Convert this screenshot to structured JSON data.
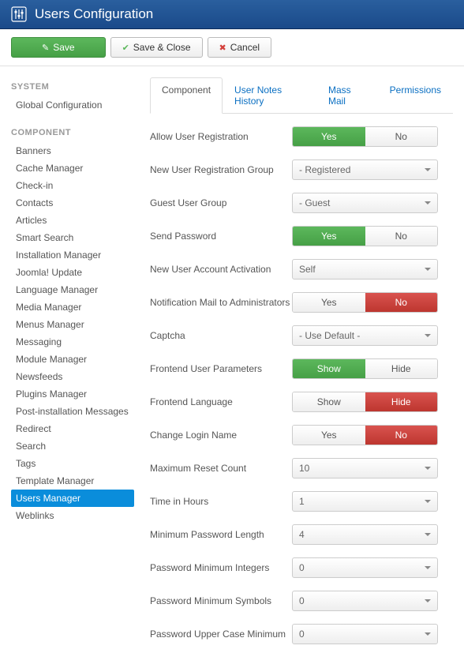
{
  "header": {
    "title": "Users Configuration"
  },
  "toolbar": {
    "save": "Save",
    "save_close": "Save & Close",
    "cancel": "Cancel"
  },
  "sidebar": {
    "system_head": "SYSTEM",
    "global_config": "Global Configuration",
    "component_head": "COMPONENT",
    "items": [
      "Banners",
      "Cache Manager",
      "Check-in",
      "Contacts",
      "Articles",
      "Smart Search",
      "Installation Manager",
      "Joomla! Update",
      "Language Manager",
      "Media Manager",
      "Menus Manager",
      "Messaging",
      "Module Manager",
      "Newsfeeds",
      "Plugins Manager",
      "Post-installation Messages",
      "Redirect",
      "Search",
      "Tags",
      "Template Manager",
      "Users Manager",
      "Weblinks"
    ],
    "active_index": 20
  },
  "tabs": {
    "items": [
      "Component",
      "User Notes History",
      "Mass Mail",
      "Permissions"
    ],
    "active_index": 0
  },
  "form": {
    "allow_reg": {
      "label": "Allow User Registration",
      "opt1": "Yes",
      "opt2": "No",
      "selected": 0,
      "style": "green"
    },
    "reg_group": {
      "label": "New User Registration Group",
      "value": "- Registered"
    },
    "guest_group": {
      "label": "Guest User Group",
      "value": "- Guest"
    },
    "send_pw": {
      "label": "Send Password",
      "opt1": "Yes",
      "opt2": "No",
      "selected": 0,
      "style": "green"
    },
    "activation": {
      "label": "New User Account Activation",
      "value": "Self"
    },
    "notif_admin": {
      "label": "Notification Mail to Administrators",
      "opt1": "Yes",
      "opt2": "No",
      "selected": 1,
      "style": "red"
    },
    "captcha": {
      "label": "Captcha",
      "value": "- Use Default -"
    },
    "fe_params": {
      "label": "Frontend User Parameters",
      "opt1": "Show",
      "opt2": "Hide",
      "selected": 0,
      "style": "green"
    },
    "fe_lang": {
      "label": "Frontend Language",
      "opt1": "Show",
      "opt2": "Hide",
      "selected": 1,
      "style": "red"
    },
    "change_login": {
      "label": "Change Login Name",
      "opt1": "Yes",
      "opt2": "No",
      "selected": 1,
      "style": "red"
    },
    "max_reset": {
      "label": "Maximum Reset Count",
      "value": "10"
    },
    "time_hours": {
      "label": "Time in Hours",
      "value": "1"
    },
    "min_pw_len": {
      "label": "Minimum Password Length",
      "value": "4"
    },
    "pw_min_int": {
      "label": "Password Minimum Integers",
      "value": "0"
    },
    "pw_min_sym": {
      "label": "Password Minimum Symbols",
      "value": "0"
    },
    "pw_upper": {
      "label": "Password Upper Case Minimum",
      "value": "0"
    }
  }
}
